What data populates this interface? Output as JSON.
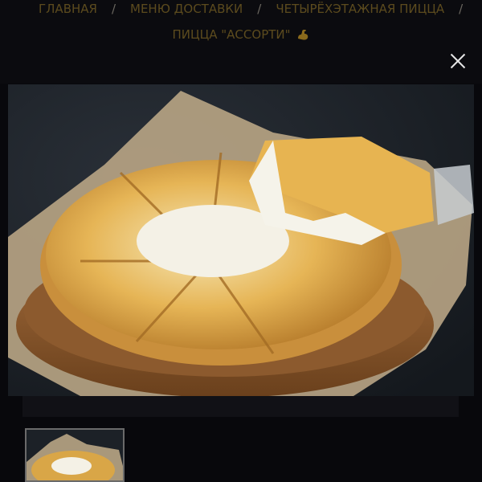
{
  "breadcrumb": {
    "items": [
      {
        "label": "ГЛАВНАЯ"
      },
      {
        "label": "МЕНЮ ДОСТАВКИ"
      },
      {
        "label": "ЧЕТЫРЁХЭТАЖНАЯ ПИЦЦА"
      }
    ],
    "separator": "/",
    "current": "ПИЦЦА \"АССОРТИ\""
  },
  "icons": {
    "current_badge": "flexed-biceps-icon",
    "close": "close-icon"
  },
  "colors": {
    "background": "#08080c",
    "breadcrumb_text": "#5c4b1e",
    "close_icon": "#e6e6e6",
    "photo_background": "#1c2127",
    "thumbnail_border": "#6a6a6a"
  },
  "gallery": {
    "main_image": "pizza-assorti-photo",
    "thumbnails": [
      {
        "name": "pizza-assorti-thumbnail",
        "selected": true
      }
    ]
  }
}
